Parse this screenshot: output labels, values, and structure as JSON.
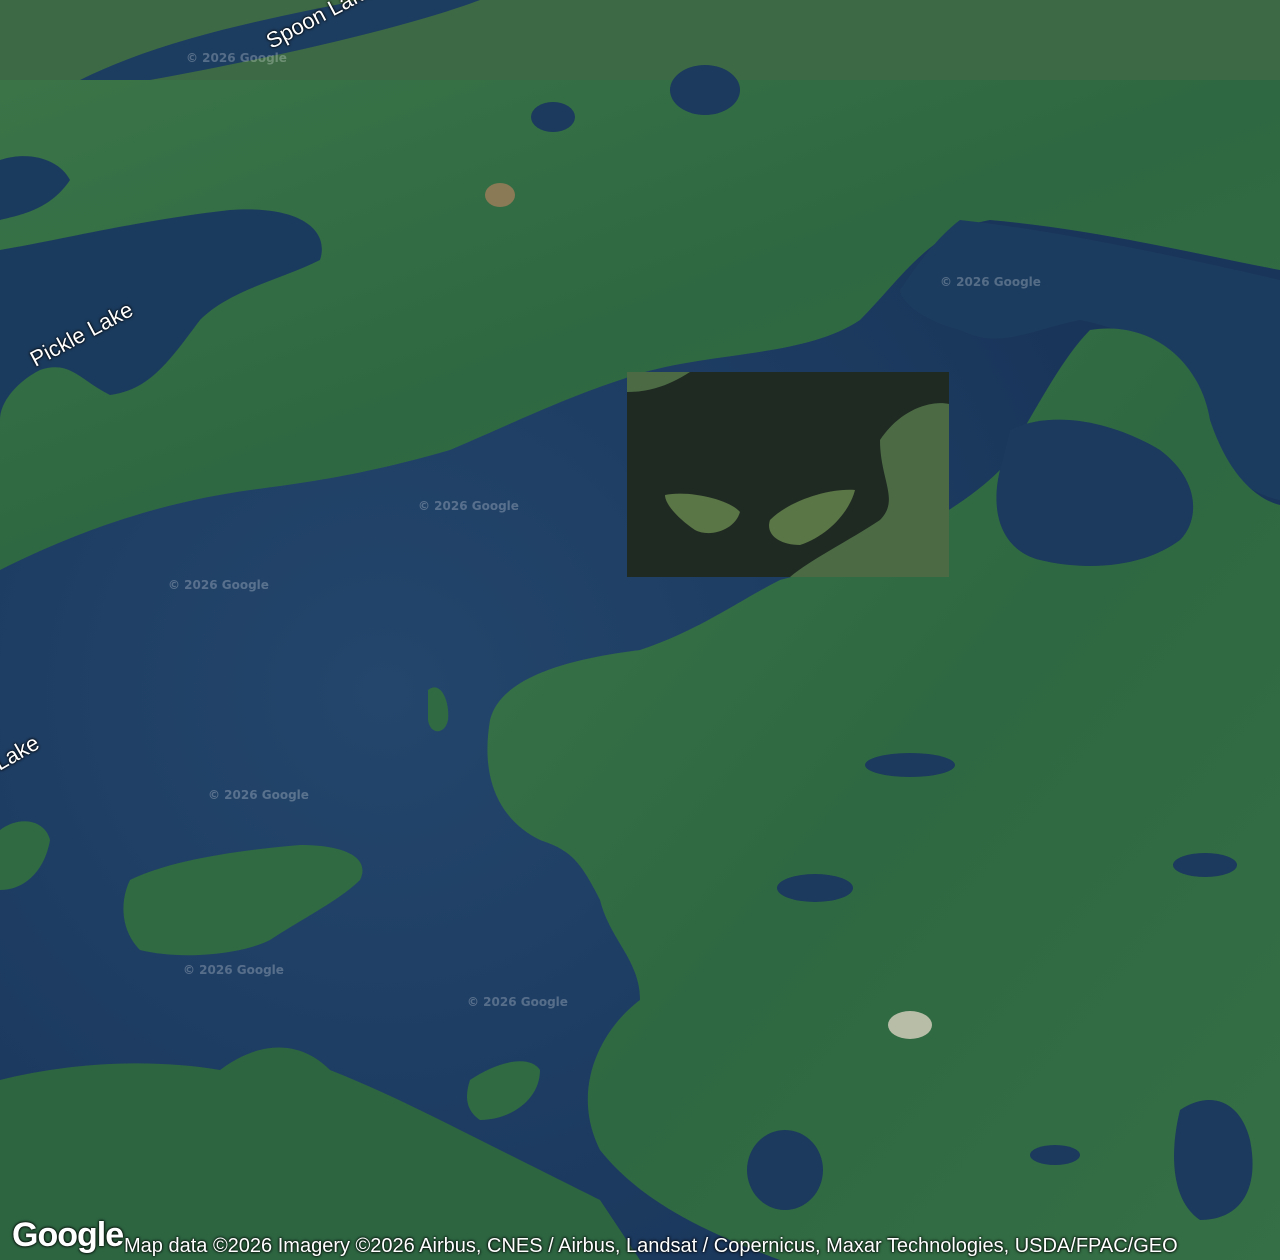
{
  "map": {
    "type": "satellite",
    "colors": {
      "water": "#1b3a5c",
      "forest": "#2f6a3c",
      "forest_dark": "#24533a",
      "tile_dark": "#1f2a22"
    },
    "labels": [
      {
        "id": "spoon",
        "text": "Spoon Lake"
      },
      {
        "id": "pickle",
        "text": "Pickle Lake"
      },
      {
        "id": "lake-left",
        "text": "Lake"
      }
    ],
    "watermark_text": "© 2026 Google"
  },
  "footer": {
    "logo": "Google",
    "attribution": "Map data ©2026 Imagery ©2026 Airbus, CNES / Airbus, Landsat / Copernicus, Maxar Technologies, USDA/FPAC/GEO"
  }
}
